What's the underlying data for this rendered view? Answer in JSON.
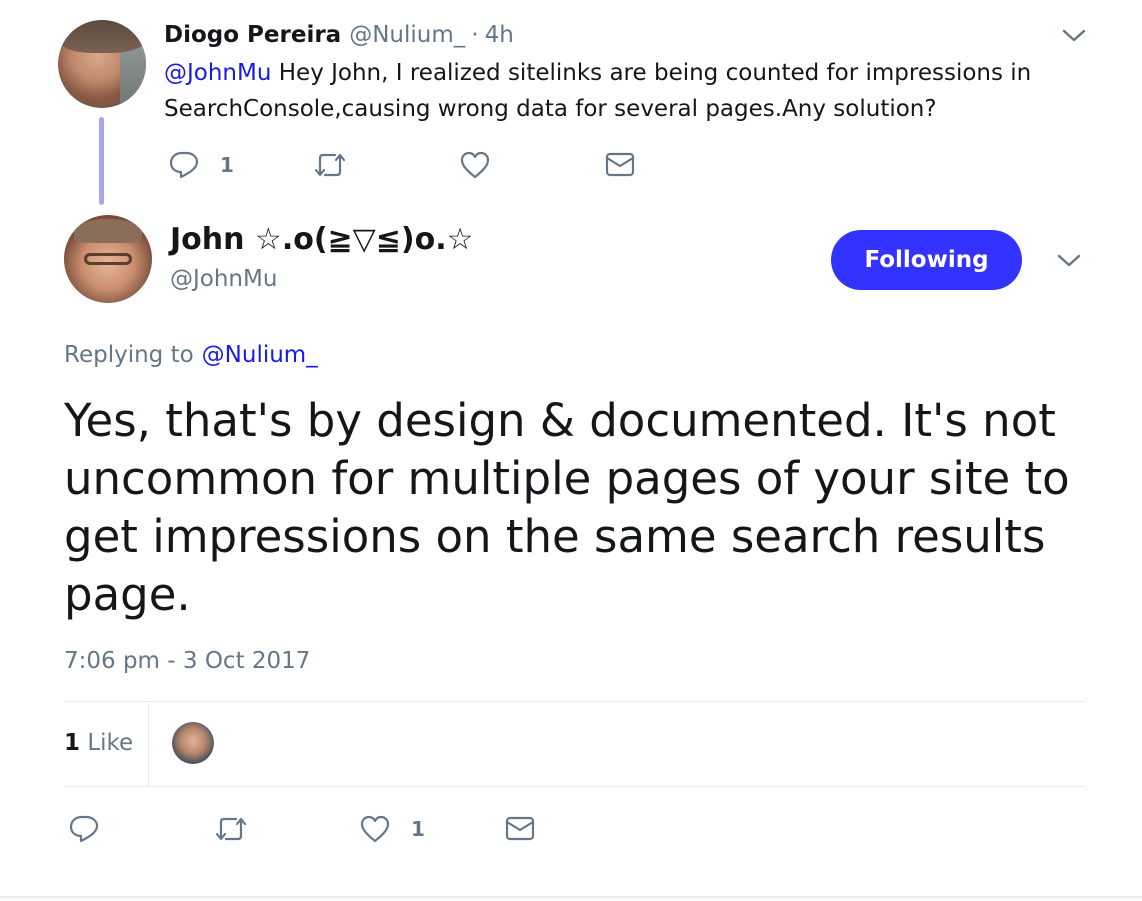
{
  "parent_tweet": {
    "author_name": "Diogo Pereira",
    "author_handle": "@Nulium_",
    "separator": "·",
    "time_ago": "4h",
    "mention": "@JohnMu",
    "text_line1": " Hey John, I realized sitelinks are being counted for impressions in",
    "text_line2": "SearchConsole,causing wrong data for several pages.Any solution?",
    "reply_count": "1"
  },
  "main_tweet": {
    "author_name": "John ☆.o(≧▽≦)o.☆",
    "author_handle": "@JohnMu",
    "follow_label": "Following",
    "replying_prefix": "Replying to",
    "replying_to": "@Nulium_",
    "text": "Yes, that's by design & documented. It's not uncommon for multiple pages of your site to get impressions on the same search results page.",
    "timestamp": "7:06 pm - 3 Oct 2017",
    "likes_count": "1",
    "likes_label": "Like",
    "like_action_count": "1"
  },
  "colors": {
    "accent": "#3333ff",
    "mention": "#1a1ae6",
    "muted": "#657786",
    "thread_line": "#a8a5ef"
  },
  "icons": [
    "chevron-down-icon",
    "reply-icon",
    "retweet-icon",
    "like-icon",
    "message-icon"
  ]
}
